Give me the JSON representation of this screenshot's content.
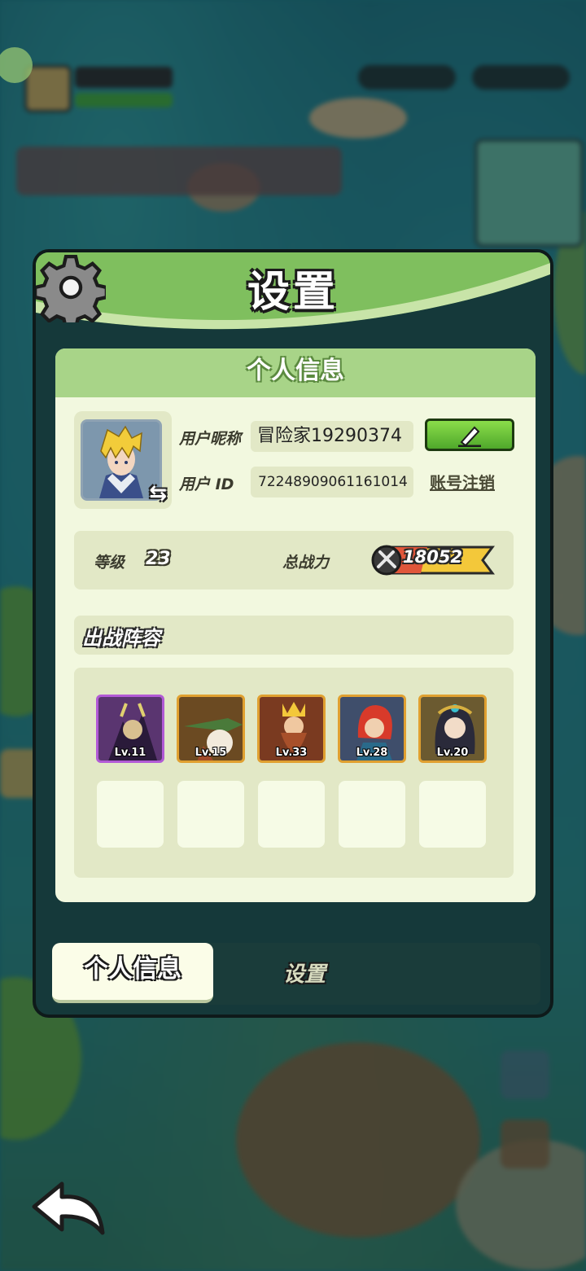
{
  "window": {
    "title": "设置"
  },
  "profile_card": {
    "header": "个人信息",
    "nickname_label": "用户昵称",
    "nickname_value": "冒险家19290374",
    "user_id_label": "用户 ID",
    "user_id_value": "72248909061161014",
    "cancel_account_label": "账号注销",
    "level_label": "等级",
    "level_value": "23",
    "power_label": "总战力",
    "power_value": "18052",
    "lineup_title": "出战阵容",
    "heroes": [
      {
        "level": "Lv.11",
        "frame": "#b25ad6",
        "bg": "#5a3570"
      },
      {
        "level": "Lv.15",
        "frame": "#e0a030",
        "bg": "#6b4a22"
      },
      {
        "level": "Lv.33",
        "frame": "#e0a030",
        "bg": "#7a3a20"
      },
      {
        "level": "Lv.28",
        "frame": "#e0a030",
        "bg": "#3f4e6b"
      },
      {
        "level": "Lv.20",
        "frame": "#e0a030",
        "bg": "#6b5a30"
      }
    ]
  },
  "tabs": [
    {
      "label": "个人信息",
      "active": true
    },
    {
      "label": "设置",
      "active": false
    }
  ],
  "colors": {
    "header_green": "#7fbf5e",
    "card_bg": "#f2f8df",
    "accent_gold": "#f3c83a"
  }
}
